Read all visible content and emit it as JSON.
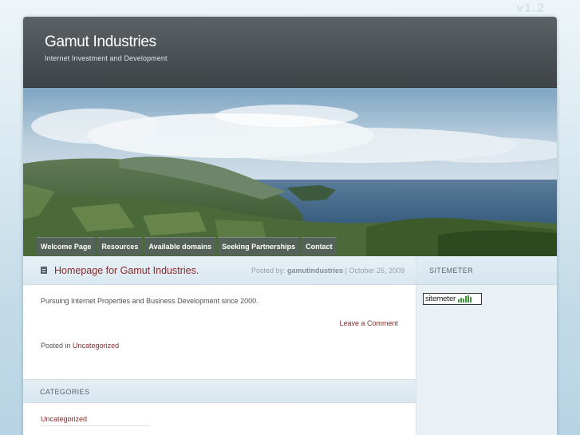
{
  "version": "v1.2",
  "site": {
    "title": "Gamut Industries",
    "description": "Internet Investment and Development"
  },
  "nav": {
    "items": [
      {
        "label": "Welcome Page"
      },
      {
        "label": "Resources"
      },
      {
        "label": "Available domains"
      },
      {
        "label": "Seeking Partnerships"
      },
      {
        "label": "Contact"
      }
    ]
  },
  "post": {
    "title": "Homepage for Gamut Industries.",
    "posted_by_label": "Posted by:",
    "author": "gamutindustries",
    "separator": "|",
    "date": "October 26, 2009",
    "body": "Pursuing Internet Properties and Business Development since 2000.",
    "comment_link": "Leave a Comment",
    "posted_in_label": "Posted in",
    "category": "Uncategorized"
  },
  "categories": {
    "heading": "CATEGORIES",
    "items": [
      "Uncategorized"
    ]
  },
  "sidebar": {
    "heading": "SITEMETER",
    "widget_label": "sitemeter"
  },
  "colors": {
    "header_bg": "#4b5054",
    "link": "#8a2a2a",
    "nav_bg": "#55625c",
    "page_bg": "#c3dbe8"
  },
  "icons": {
    "post": "post-document-icon",
    "sitemeter": "sitemeter-bars-icon"
  }
}
